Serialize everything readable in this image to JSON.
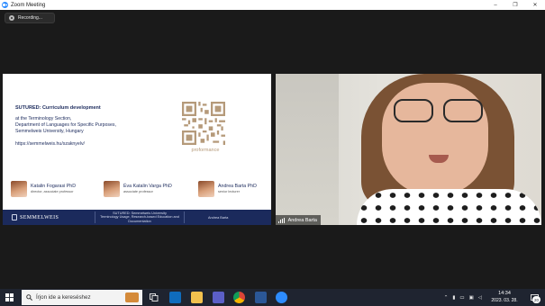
{
  "window": {
    "title": "Zoom Meeting",
    "controls": {
      "minimize": "–",
      "restore": "❐",
      "close": "✕"
    }
  },
  "recording": {
    "label": "Recording..."
  },
  "slide": {
    "title": "SUTURED: Curriculum development",
    "subtitle_lines": [
      "at the Terminology Section,",
      "Department of Languages for Specific Purposes,",
      "Semmelweis University, Hungary"
    ],
    "url": "https://semmelweis.hu/szaknyelv/",
    "qr_caption": "proformance",
    "people": [
      {
        "name": "Katalin Fogarasi PhD",
        "role": "director, associate professor"
      },
      {
        "name": "Éva Katalin Varga PhD",
        "role": "associate professor"
      },
      {
        "name": "Andrea Barta PhD",
        "role": "senior lecturer"
      }
    ],
    "footer": {
      "logo": "SEMMELWEIS",
      "logo_sub": "UNIVERSITY 1769",
      "middle_lines": [
        "SUTURED: Semmelweis University",
        "Terminology Usage, Research-based Education and Documentation"
      ],
      "right": "Andrea Barta"
    }
  },
  "video": {
    "participant_name": "Andrea Barta"
  },
  "taskbar": {
    "search_placeholder": "Írjon ide a kereséshez",
    "icons": [
      "task-view-icon",
      "outlook-icon",
      "file-explorer-icon",
      "teams-icon",
      "chrome-icon",
      "word-icon",
      "zoom-icon"
    ],
    "time": "14:34",
    "date": "2023. 03. 28.",
    "notification_count": "20"
  },
  "colors": {
    "zoom_blue": "#2d8cff",
    "slide_navy": "#1b2a5c",
    "qr_gold": "#b59a7a",
    "taskbar": "#1f2430"
  }
}
